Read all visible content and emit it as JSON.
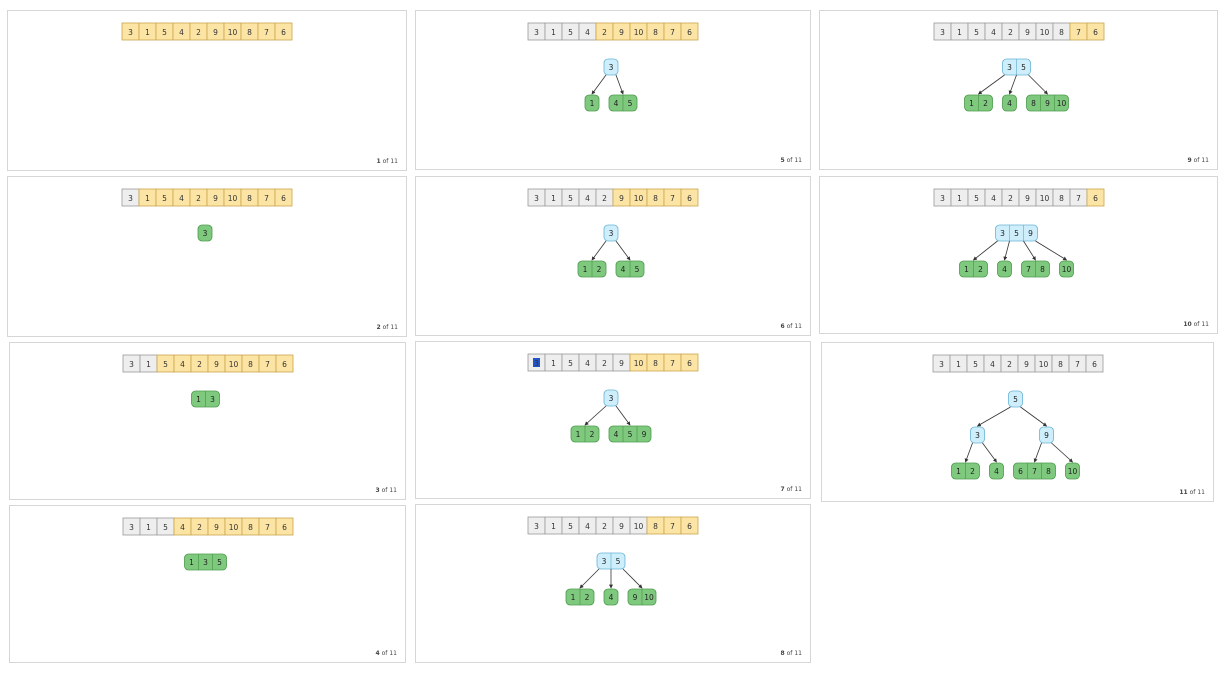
{
  "array": [
    "3",
    "1",
    "5",
    "4",
    "2",
    "9",
    "10",
    "8",
    "7",
    "6"
  ],
  "total": "11",
  "of_label": "of",
  "colors": {
    "pending": "#fce4a4",
    "pending_border": "#c9a64c",
    "done": "#eeeeee",
    "done_border": "#9a9a9a",
    "selected": "#2255cc",
    "leaf": "#7fc97f",
    "leaf_border": "#4c9a4c",
    "internal": "#cdeefa",
    "internal_border": "#6ab4d6",
    "edge": "#333333"
  },
  "steps": [
    {
      "step": "1",
      "pending_from": 0,
      "tree": {
        "leaf": true,
        "keys": []
      }
    },
    {
      "step": "2",
      "pending_from": 1,
      "tree": {
        "leaf": true,
        "keys": [
          "3"
        ]
      }
    },
    {
      "step": "3",
      "pending_from": 2,
      "tree": {
        "leaf": true,
        "keys": [
          "1",
          "3"
        ]
      }
    },
    {
      "step": "4",
      "pending_from": 3,
      "tree": {
        "leaf": true,
        "keys": [
          "1",
          "3",
          "5"
        ]
      }
    },
    {
      "step": "5",
      "pending_from": 4,
      "tree": {
        "leaf": false,
        "keys": [
          "3"
        ],
        "children": [
          {
            "leaf": true,
            "keys": [
              "1"
            ]
          },
          {
            "leaf": true,
            "keys": [
              "4",
              "5"
            ]
          }
        ]
      }
    },
    {
      "step": "6",
      "pending_from": 5,
      "tree": {
        "leaf": false,
        "keys": [
          "3"
        ],
        "children": [
          {
            "leaf": true,
            "keys": [
              "1",
              "2"
            ]
          },
          {
            "leaf": true,
            "keys": [
              "4",
              "5"
            ]
          }
        ]
      }
    },
    {
      "step": "7",
      "pending_from": 6,
      "selected": 0,
      "tree": {
        "leaf": false,
        "keys": [
          "3"
        ],
        "children": [
          {
            "leaf": true,
            "keys": [
              "1",
              "2"
            ]
          },
          {
            "leaf": true,
            "keys": [
              "4",
              "5",
              "9"
            ]
          }
        ]
      }
    },
    {
      "step": "8",
      "pending_from": 7,
      "tree": {
        "leaf": false,
        "keys": [
          "3",
          "5"
        ],
        "children": [
          {
            "leaf": true,
            "keys": [
              "1",
              "2"
            ]
          },
          {
            "leaf": true,
            "keys": [
              "4"
            ]
          },
          {
            "leaf": true,
            "keys": [
              "9",
              "10"
            ]
          }
        ]
      }
    },
    {
      "step": "9",
      "pending_from": 8,
      "tree": {
        "leaf": false,
        "keys": [
          "3",
          "5"
        ],
        "children": [
          {
            "leaf": true,
            "keys": [
              "1",
              "2"
            ]
          },
          {
            "leaf": true,
            "keys": [
              "4"
            ]
          },
          {
            "leaf": true,
            "keys": [
              "8",
              "9",
              "10"
            ]
          }
        ]
      }
    },
    {
      "step": "10",
      "pending_from": 9,
      "tree": {
        "leaf": false,
        "keys": [
          "3",
          "5",
          "9"
        ],
        "children": [
          {
            "leaf": true,
            "keys": [
              "1",
              "2"
            ]
          },
          {
            "leaf": true,
            "keys": [
              "4"
            ]
          },
          {
            "leaf": true,
            "keys": [
              "7",
              "8"
            ]
          },
          {
            "leaf": true,
            "keys": [
              "10"
            ]
          }
        ]
      }
    },
    {
      "step": "11",
      "pending_from": 10,
      "tree": {
        "leaf": false,
        "keys": [
          "5"
        ],
        "children": [
          {
            "leaf": false,
            "keys": [
              "3"
            ],
            "children": [
              {
                "leaf": true,
                "keys": [
                  "1",
                  "2"
                ]
              },
              {
                "leaf": true,
                "keys": [
                  "4"
                ]
              }
            ]
          },
          {
            "leaf": false,
            "keys": [
              "9"
            ],
            "children": [
              {
                "leaf": true,
                "keys": [
                  "6",
                  "7",
                  "8"
                ]
              },
              {
                "leaf": true,
                "keys": [
                  "10"
                ]
              }
            ]
          }
        ]
      }
    }
  ]
}
